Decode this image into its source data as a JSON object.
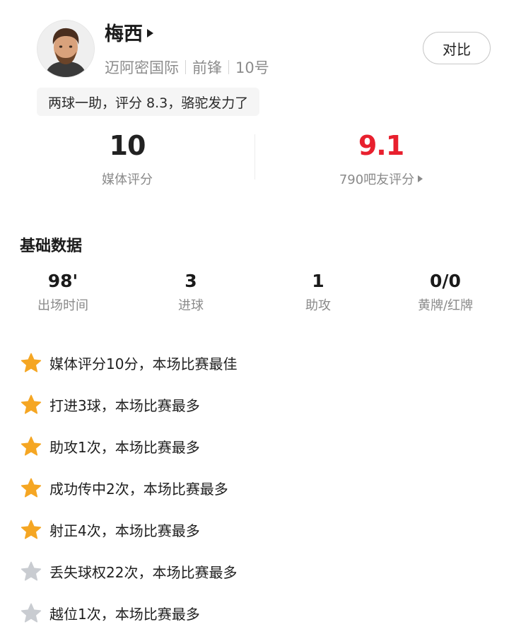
{
  "player": {
    "name": "梅西",
    "club": "迈阿密国际",
    "position": "前锋",
    "number": "10号",
    "comment": "两球一助，评分 8.3，骆驼发力了"
  },
  "compare_label": "对比",
  "ratings": {
    "media": {
      "value": "10",
      "label": "媒体评分"
    },
    "fans": {
      "value": "9.1",
      "label": "790吧友评分",
      "color": "#e8202e"
    }
  },
  "basic_stats": {
    "title": "基础数据",
    "items": [
      {
        "value": "98'",
        "label": "出场时间"
      },
      {
        "value": "3",
        "label": "进球"
      },
      {
        "value": "1",
        "label": "助攻"
      },
      {
        "value": "0/0",
        "label": "黄牌/红牌"
      }
    ]
  },
  "highlights": [
    {
      "text": "媒体评分10分，本场比赛最佳",
      "icon": "gold-star-icon",
      "color": "#f5a623"
    },
    {
      "text": "打进3球，本场比赛最多",
      "icon": "gold-star-icon",
      "color": "#f5a623"
    },
    {
      "text": "助攻1次，本场比赛最多",
      "icon": "gold-star-icon",
      "color": "#f5a623"
    },
    {
      "text": "成功传中2次，本场比赛最多",
      "icon": "gold-star-icon",
      "color": "#f5a623"
    },
    {
      "text": "射正4次，本场比赛最多",
      "icon": "gold-star-icon",
      "color": "#f5a623"
    },
    {
      "text": "丢失球权22次，本场比赛最多",
      "icon": "gray-star-icon",
      "color": "#c9ccd1"
    },
    {
      "text": "越位1次，本场比赛最多",
      "icon": "gray-star-icon",
      "color": "#c9ccd1"
    }
  ]
}
